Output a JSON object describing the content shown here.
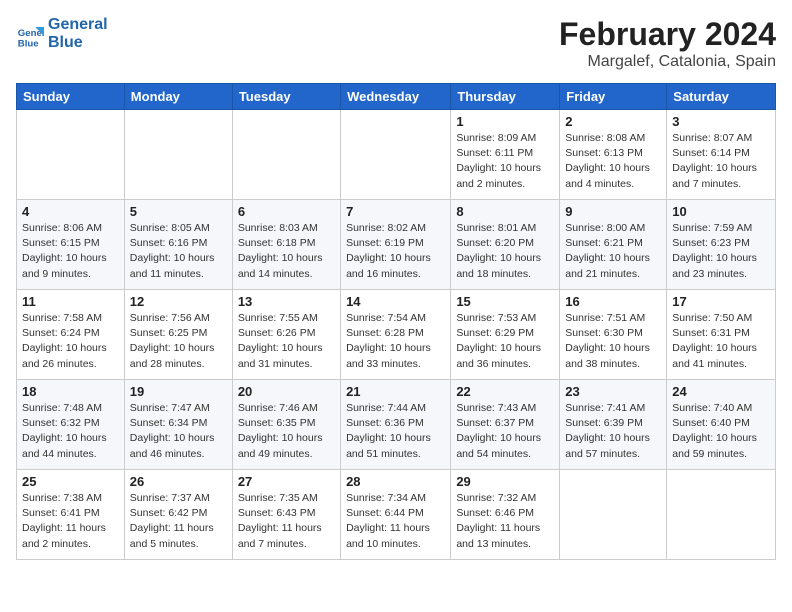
{
  "header": {
    "logo_line1": "General",
    "logo_line2": "Blue",
    "month_title": "February 2024",
    "location": "Margalef, Catalonia, Spain"
  },
  "days_of_week": [
    "Sunday",
    "Monday",
    "Tuesday",
    "Wednesday",
    "Thursday",
    "Friday",
    "Saturday"
  ],
  "weeks": [
    [
      {
        "day": "",
        "info": ""
      },
      {
        "day": "",
        "info": ""
      },
      {
        "day": "",
        "info": ""
      },
      {
        "day": "",
        "info": ""
      },
      {
        "day": "1",
        "info": "Sunrise: 8:09 AM\nSunset: 6:11 PM\nDaylight: 10 hours\nand 2 minutes."
      },
      {
        "day": "2",
        "info": "Sunrise: 8:08 AM\nSunset: 6:13 PM\nDaylight: 10 hours\nand 4 minutes."
      },
      {
        "day": "3",
        "info": "Sunrise: 8:07 AM\nSunset: 6:14 PM\nDaylight: 10 hours\nand 7 minutes."
      }
    ],
    [
      {
        "day": "4",
        "info": "Sunrise: 8:06 AM\nSunset: 6:15 PM\nDaylight: 10 hours\nand 9 minutes."
      },
      {
        "day": "5",
        "info": "Sunrise: 8:05 AM\nSunset: 6:16 PM\nDaylight: 10 hours\nand 11 minutes."
      },
      {
        "day": "6",
        "info": "Sunrise: 8:03 AM\nSunset: 6:18 PM\nDaylight: 10 hours\nand 14 minutes."
      },
      {
        "day": "7",
        "info": "Sunrise: 8:02 AM\nSunset: 6:19 PM\nDaylight: 10 hours\nand 16 minutes."
      },
      {
        "day": "8",
        "info": "Sunrise: 8:01 AM\nSunset: 6:20 PM\nDaylight: 10 hours\nand 18 minutes."
      },
      {
        "day": "9",
        "info": "Sunrise: 8:00 AM\nSunset: 6:21 PM\nDaylight: 10 hours\nand 21 minutes."
      },
      {
        "day": "10",
        "info": "Sunrise: 7:59 AM\nSunset: 6:23 PM\nDaylight: 10 hours\nand 23 minutes."
      }
    ],
    [
      {
        "day": "11",
        "info": "Sunrise: 7:58 AM\nSunset: 6:24 PM\nDaylight: 10 hours\nand 26 minutes."
      },
      {
        "day": "12",
        "info": "Sunrise: 7:56 AM\nSunset: 6:25 PM\nDaylight: 10 hours\nand 28 minutes."
      },
      {
        "day": "13",
        "info": "Sunrise: 7:55 AM\nSunset: 6:26 PM\nDaylight: 10 hours\nand 31 minutes."
      },
      {
        "day": "14",
        "info": "Sunrise: 7:54 AM\nSunset: 6:28 PM\nDaylight: 10 hours\nand 33 minutes."
      },
      {
        "day": "15",
        "info": "Sunrise: 7:53 AM\nSunset: 6:29 PM\nDaylight: 10 hours\nand 36 minutes."
      },
      {
        "day": "16",
        "info": "Sunrise: 7:51 AM\nSunset: 6:30 PM\nDaylight: 10 hours\nand 38 minutes."
      },
      {
        "day": "17",
        "info": "Sunrise: 7:50 AM\nSunset: 6:31 PM\nDaylight: 10 hours\nand 41 minutes."
      }
    ],
    [
      {
        "day": "18",
        "info": "Sunrise: 7:48 AM\nSunset: 6:32 PM\nDaylight: 10 hours\nand 44 minutes."
      },
      {
        "day": "19",
        "info": "Sunrise: 7:47 AM\nSunset: 6:34 PM\nDaylight: 10 hours\nand 46 minutes."
      },
      {
        "day": "20",
        "info": "Sunrise: 7:46 AM\nSunset: 6:35 PM\nDaylight: 10 hours\nand 49 minutes."
      },
      {
        "day": "21",
        "info": "Sunrise: 7:44 AM\nSunset: 6:36 PM\nDaylight: 10 hours\nand 51 minutes."
      },
      {
        "day": "22",
        "info": "Sunrise: 7:43 AM\nSunset: 6:37 PM\nDaylight: 10 hours\nand 54 minutes."
      },
      {
        "day": "23",
        "info": "Sunrise: 7:41 AM\nSunset: 6:39 PM\nDaylight: 10 hours\nand 57 minutes."
      },
      {
        "day": "24",
        "info": "Sunrise: 7:40 AM\nSunset: 6:40 PM\nDaylight: 10 hours\nand 59 minutes."
      }
    ],
    [
      {
        "day": "25",
        "info": "Sunrise: 7:38 AM\nSunset: 6:41 PM\nDaylight: 11 hours\nand 2 minutes."
      },
      {
        "day": "26",
        "info": "Sunrise: 7:37 AM\nSunset: 6:42 PM\nDaylight: 11 hours\nand 5 minutes."
      },
      {
        "day": "27",
        "info": "Sunrise: 7:35 AM\nSunset: 6:43 PM\nDaylight: 11 hours\nand 7 minutes."
      },
      {
        "day": "28",
        "info": "Sunrise: 7:34 AM\nSunset: 6:44 PM\nDaylight: 11 hours\nand 10 minutes."
      },
      {
        "day": "29",
        "info": "Sunrise: 7:32 AM\nSunset: 6:46 PM\nDaylight: 11 hours\nand 13 minutes."
      },
      {
        "day": "",
        "info": ""
      },
      {
        "day": "",
        "info": ""
      }
    ]
  ]
}
